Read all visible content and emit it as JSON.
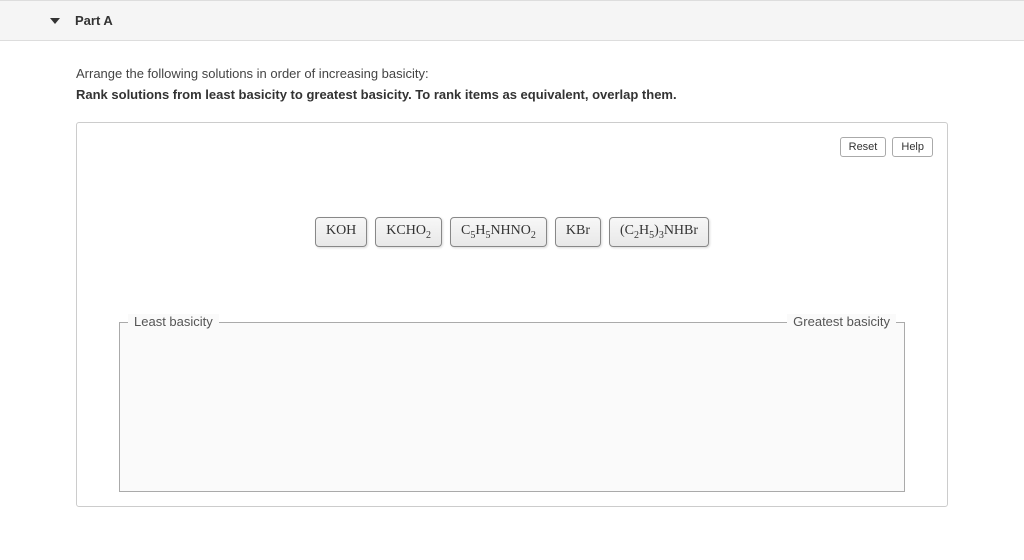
{
  "header": {
    "part_label": "Part A"
  },
  "instructions": {
    "line1": "Arrange the following solutions in order of increasing basicity:",
    "line2": "Rank solutions from least basicity to greatest basicity. To rank items as equivalent, overlap them."
  },
  "buttons": {
    "reset": "Reset",
    "help": "Help"
  },
  "tiles": [
    {
      "html": "KOH"
    },
    {
      "html": "KCHO<sub>2</sub>"
    },
    {
      "html": "C<sub>5</sub>H<sub>5</sub>NHNO<sub>2</sub>"
    },
    {
      "html": "KBr"
    },
    {
      "html": "(C<sub>2</sub>H<sub>5</sub>)<sub>3</sub>NHBr"
    }
  ],
  "dropzone": {
    "left_label": "Least basicity",
    "right_label": "Greatest basicity"
  }
}
